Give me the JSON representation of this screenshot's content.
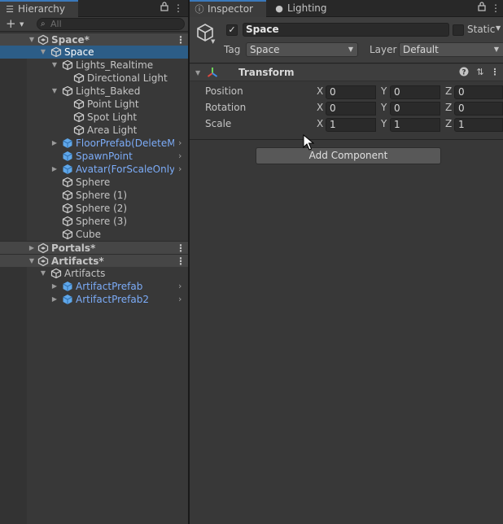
{
  "hierarchy": {
    "tab_label": "Hierarchy",
    "search_placeholder": "All",
    "rows": [
      {
        "label": "Space*",
        "depth": 0,
        "kind": "scene",
        "fold": "open"
      },
      {
        "label": "Space",
        "depth": 1,
        "kind": "object",
        "fold": "open",
        "selected": true
      },
      {
        "label": "Lights_Realtime",
        "depth": 2,
        "kind": "object",
        "fold": "open"
      },
      {
        "label": "Directional Light",
        "depth": 3,
        "kind": "object"
      },
      {
        "label": "Lights_Baked",
        "depth": 2,
        "kind": "object",
        "fold": "open"
      },
      {
        "label": "Point Light",
        "depth": 3,
        "kind": "object"
      },
      {
        "label": "Spot Light",
        "depth": 3,
        "kind": "object"
      },
      {
        "label": "Area Light",
        "depth": 3,
        "kind": "object"
      },
      {
        "label": "FloorPrefab(DeleteMe",
        "depth": 2,
        "kind": "prefab",
        "fold": "closed",
        "arrow": true
      },
      {
        "label": "SpawnPoint",
        "depth": 2,
        "kind": "prefab",
        "arrow": true
      },
      {
        "label": "Avatar(ForScaleOnly)",
        "depth": 2,
        "kind": "prefab",
        "fold": "closed",
        "arrow": true
      },
      {
        "label": "Sphere",
        "depth": 2,
        "kind": "object"
      },
      {
        "label": "Sphere (1)",
        "depth": 2,
        "kind": "object"
      },
      {
        "label": "Sphere (2)",
        "depth": 2,
        "kind": "object"
      },
      {
        "label": "Sphere (3)",
        "depth": 2,
        "kind": "object"
      },
      {
        "label": "Cube",
        "depth": 2,
        "kind": "object"
      },
      {
        "label": "Portals*",
        "depth": 0,
        "kind": "scene",
        "fold": "closed"
      },
      {
        "label": "Artifacts*",
        "depth": 0,
        "kind": "scene",
        "fold": "open"
      },
      {
        "label": "Artifacts",
        "depth": 1,
        "kind": "object",
        "fold": "open"
      },
      {
        "label": "ArtifactPrefab",
        "depth": 2,
        "kind": "prefab",
        "fold": "closed",
        "arrow": true
      },
      {
        "label": "ArtifactPrefab2",
        "depth": 2,
        "kind": "prefab",
        "fold": "closed",
        "arrow": true
      }
    ]
  },
  "inspector": {
    "tab_label": "Inspector",
    "lighting_tab_label": "Lighting",
    "object_name": "Space",
    "static_label": "Static",
    "tag_label": "Tag",
    "tag_value": "Space",
    "layer_label": "Layer",
    "layer_value": "Default",
    "component_title": "Transform",
    "properties": [
      {
        "label": "Position",
        "x": "0",
        "y": "0",
        "z": "0"
      },
      {
        "label": "Rotation",
        "x": "0",
        "y": "0",
        "z": "0"
      },
      {
        "label": "Scale",
        "x": "1",
        "y": "1",
        "z": "1"
      }
    ],
    "axis_labels": [
      "X",
      "Y",
      "Z"
    ],
    "add_component_label": "Add Component"
  },
  "icons": {
    "hierarchy_tab": "list-icon",
    "inspector_tab": "info-icon",
    "lighting_tab": "bulb-icon",
    "lock": "lock-icon",
    "menu": "kebab-menu-icon",
    "search": "search-icon",
    "scene": "unity-scene-icon",
    "game_object": "cube-outline-icon",
    "prefab": "prefab-cube-icon",
    "help": "help-icon",
    "presets": "sliders-icon"
  },
  "colors": {
    "selection": "#2c5d87",
    "prefab_text": "#7cacf8",
    "panel_bg": "#383838",
    "active_tab_accent": "#3a79bb"
  }
}
